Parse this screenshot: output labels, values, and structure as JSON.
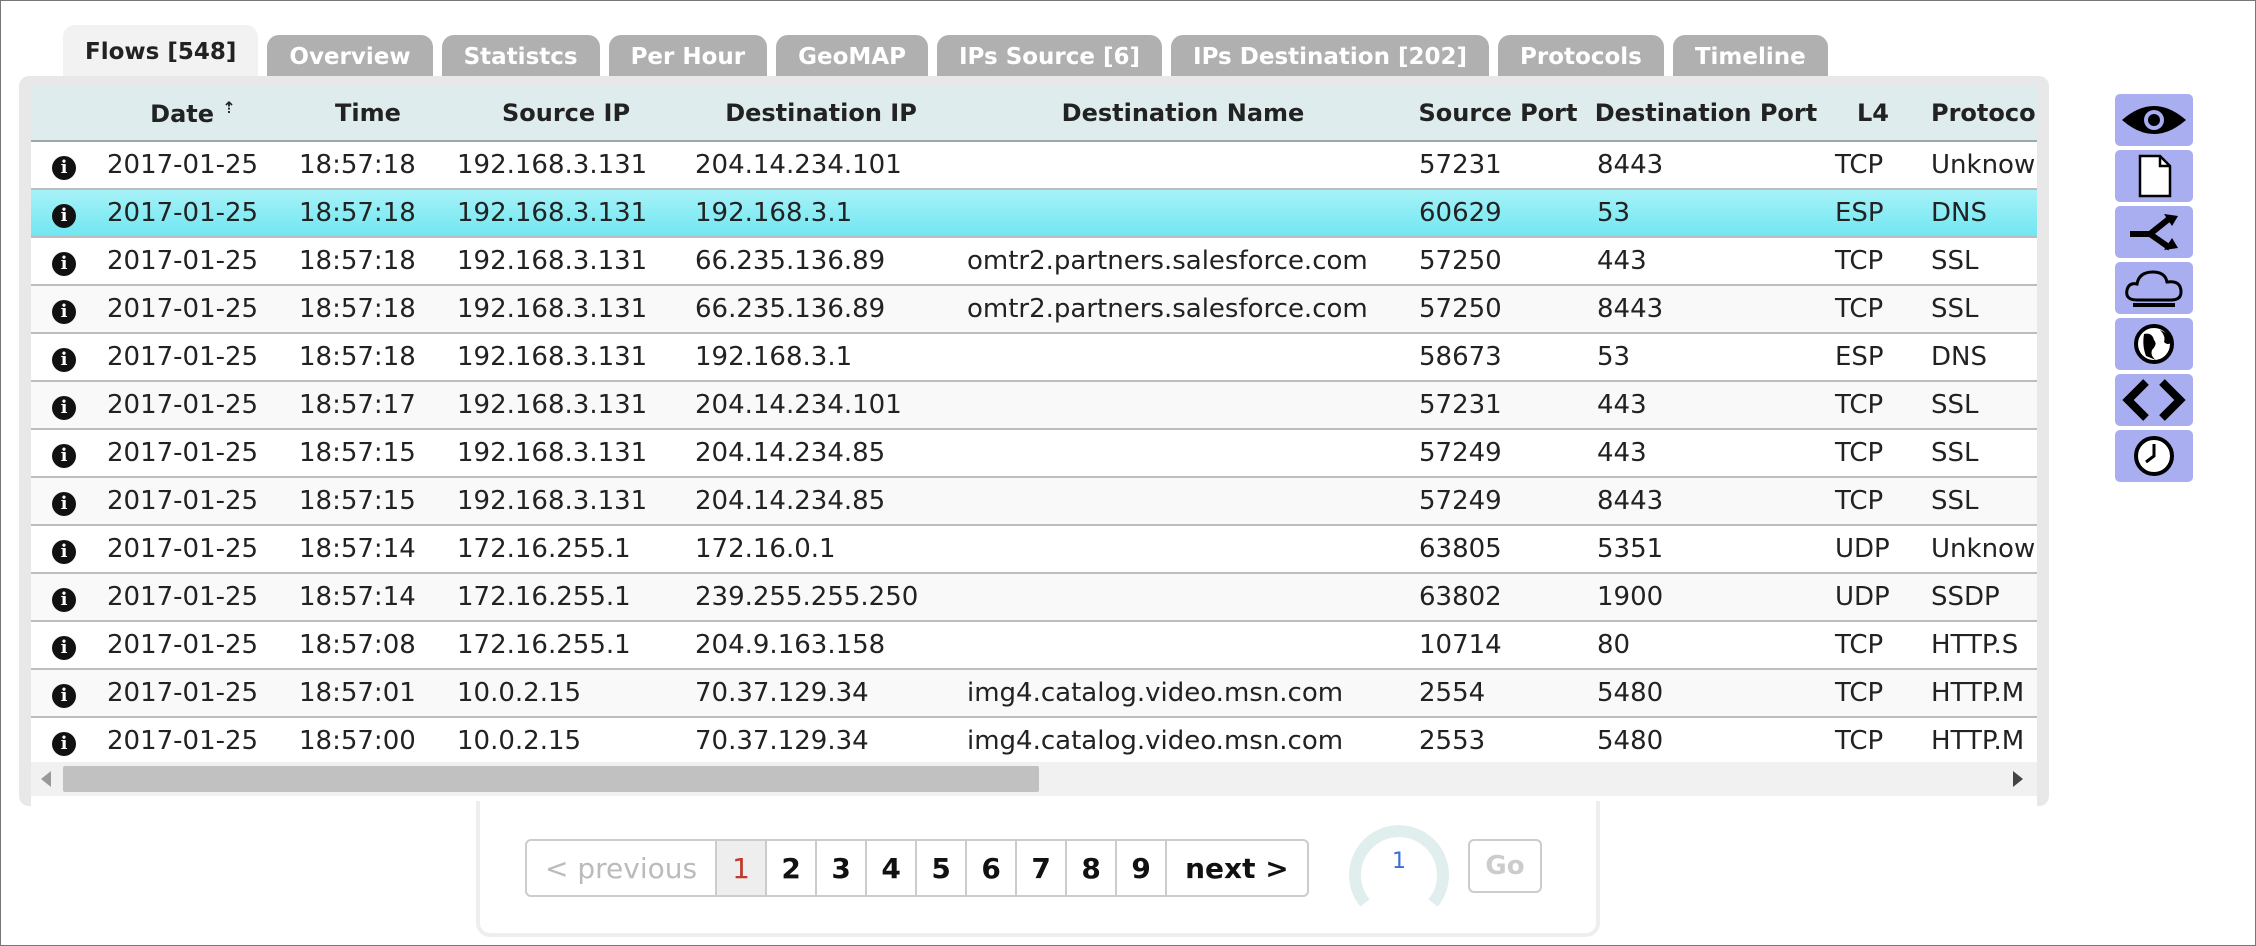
{
  "tabs": [
    {
      "label": "Flows [548]",
      "active": true
    },
    {
      "label": "Overview"
    },
    {
      "label": "Statistcs"
    },
    {
      "label": "Per Hour"
    },
    {
      "label": "GeoMAP"
    },
    {
      "label": "IPs Source [6]"
    },
    {
      "label": "IPs Destination [202]"
    },
    {
      "label": "Protocols"
    },
    {
      "label": "Timeline"
    }
  ],
  "table": {
    "columns": [
      "",
      "Date",
      "Time",
      "Source IP",
      "Destination IP",
      "Destination Name",
      "Source Port",
      "Destination Port",
      "L4",
      "Protocol"
    ],
    "sort_column": "Date",
    "sort_icon": "sort-up-icon",
    "rows": [
      [
        "2017-01-25",
        "18:57:18",
        "192.168.3.131",
        "204.14.234.101",
        "",
        "57231",
        "8443",
        "TCP",
        "Unknown"
      ],
      [
        "2017-01-25",
        "18:57:18",
        "192.168.3.131",
        "192.168.3.1",
        "",
        "60629",
        "53",
        "ESP",
        "DNS"
      ],
      [
        "2017-01-25",
        "18:57:18",
        "192.168.3.131",
        "66.235.136.89",
        "omtr2.partners.salesforce.com",
        "57250",
        "443",
        "TCP",
        "SSL"
      ],
      [
        "2017-01-25",
        "18:57:18",
        "192.168.3.131",
        "66.235.136.89",
        "omtr2.partners.salesforce.com",
        "57250",
        "8443",
        "TCP",
        "SSL"
      ],
      [
        "2017-01-25",
        "18:57:18",
        "192.168.3.131",
        "192.168.3.1",
        "",
        "58673",
        "53",
        "ESP",
        "DNS"
      ],
      [
        "2017-01-25",
        "18:57:17",
        "192.168.3.131",
        "204.14.234.101",
        "",
        "57231",
        "443",
        "TCP",
        "SSL"
      ],
      [
        "2017-01-25",
        "18:57:15",
        "192.168.3.131",
        "204.14.234.85",
        "",
        "57249",
        "443",
        "TCP",
        "SSL"
      ],
      [
        "2017-01-25",
        "18:57:15",
        "192.168.3.131",
        "204.14.234.85",
        "",
        "57249",
        "8443",
        "TCP",
        "SSL"
      ],
      [
        "2017-01-25",
        "18:57:14",
        "172.16.255.1",
        "172.16.0.1",
        "",
        "63805",
        "5351",
        "UDP",
        "Unknown"
      ],
      [
        "2017-01-25",
        "18:57:14",
        "172.16.255.1",
        "239.255.255.250",
        "",
        "63802",
        "1900",
        "UDP",
        "SSDP"
      ],
      [
        "2017-01-25",
        "18:57:08",
        "172.16.255.1",
        "204.9.163.158",
        "",
        "10714",
        "80",
        "TCP",
        "HTTP.S"
      ],
      [
        "2017-01-25",
        "18:57:01",
        "10.0.2.15",
        "70.37.129.34",
        "img4.catalog.video.msn.com",
        "2554",
        "5480",
        "TCP",
        "HTTP.M"
      ],
      [
        "2017-01-25",
        "18:57:00",
        "10.0.2.15",
        "70.37.129.34",
        "img4.catalog.video.msn.com",
        "2553",
        "5480",
        "TCP",
        "HTTP.M"
      ]
    ],
    "highlighted_row": 1
  },
  "pagination": {
    "previous_label": "< previous",
    "pages": [
      "1",
      "2",
      "3",
      "4",
      "5",
      "6",
      "7",
      "8",
      "9"
    ],
    "current_page": "1",
    "next_label": "next >",
    "go_label": "Go",
    "gauge_value": "1"
  },
  "side_toolbar": [
    {
      "icon": "eye-icon"
    },
    {
      "icon": "document-icon"
    },
    {
      "icon": "branch-icon"
    },
    {
      "icon": "cloud-protocols-icon"
    },
    {
      "icon": "globe-icon"
    },
    {
      "icon": "code-brackets-icon"
    },
    {
      "icon": "clock-icon"
    }
  ],
  "colors": {
    "header_bg": "#deeced",
    "highlight_row": "#6fe6f1",
    "tab_inactive": "#b0b0b0",
    "toolbar_button": "#a8aef0",
    "current_page": "#c0392b"
  }
}
